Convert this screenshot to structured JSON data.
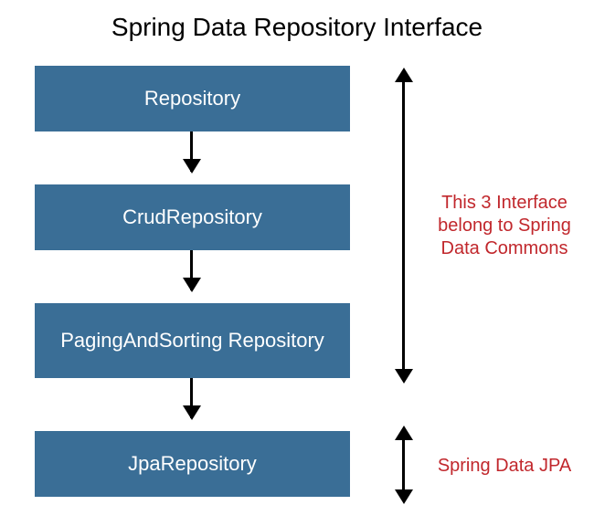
{
  "title": "Spring Data Repository Interface",
  "boxes": {
    "b1": "Repository",
    "b2": "CrudRepository",
    "b3": "PagingAndSorting Repository",
    "b4": "JpaRepository"
  },
  "notes": {
    "commons": "This 3 Interface belong to Spring Data Commons",
    "jpa": "Spring Data JPA"
  },
  "colors": {
    "box_bg": "#3a6e96",
    "box_text": "#ffffff",
    "note_text": "#c1272c"
  }
}
